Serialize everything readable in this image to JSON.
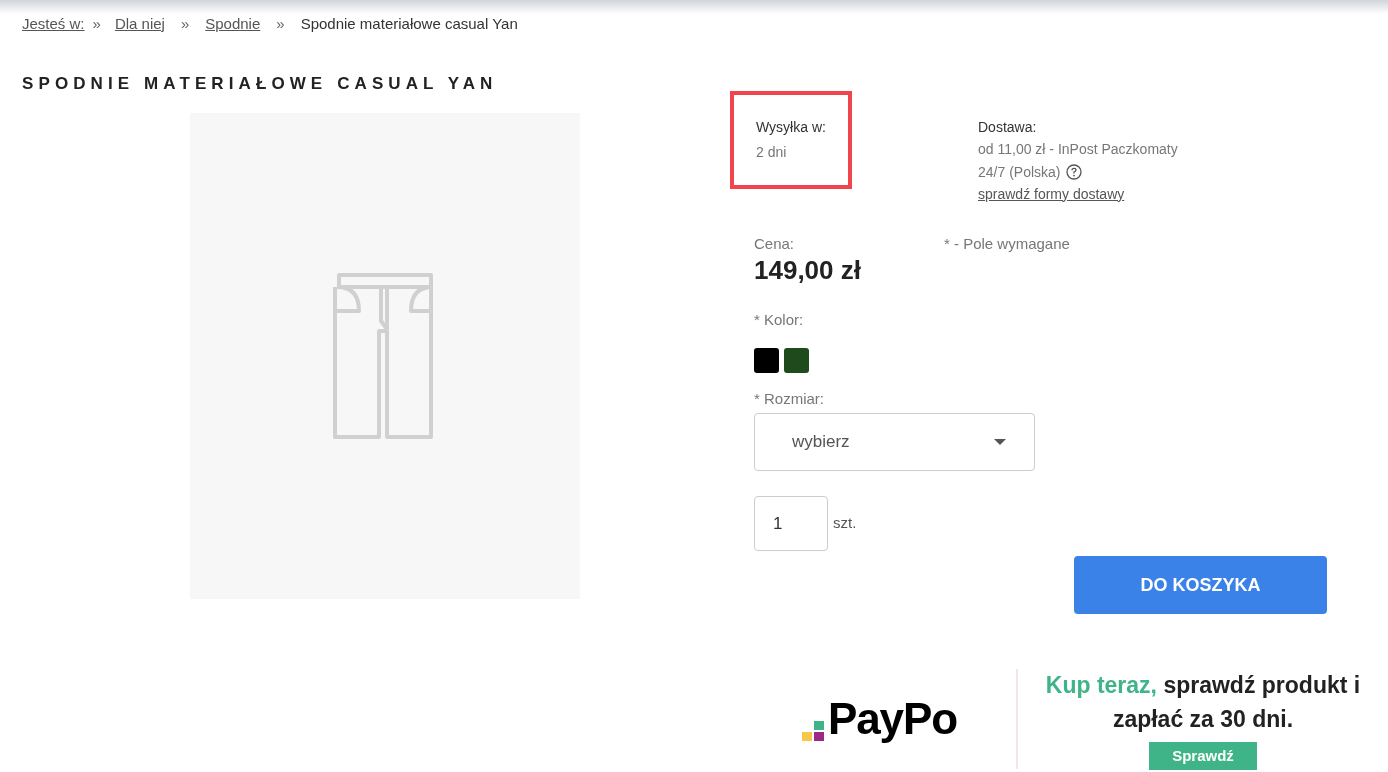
{
  "breadcrumbs": [
    {
      "label": "Jesteś w:",
      "link": true
    },
    {
      "label": "Dla niej",
      "link": true
    },
    {
      "label": "Spodnie",
      "link": true
    },
    {
      "label": "Spodnie materiałowe casual Yan",
      "link": false
    }
  ],
  "breadcrumb_separator": "»",
  "product_title": "SPODNIE MATERIAŁOWE CASUAL YAN",
  "shipping": {
    "label": "Wysyłka w:",
    "value": "2 dni",
    "highlighted": true
  },
  "delivery": {
    "label": "Dostawa:",
    "value": "od 11,00 zł - InPost Paczkomaty 24/7 (Polska)",
    "help_icon": true,
    "link": "sprawdź formy dostawy"
  },
  "price": {
    "label": "Cena:",
    "value": "149,00 zł"
  },
  "required_note": "* - Pole wymagane",
  "color": {
    "label": "* Kolor:",
    "swatches": [
      {
        "color": "#000000",
        "selected": false
      },
      {
        "color": "#1f4a1c",
        "selected": false
      }
    ]
  },
  "size": {
    "label": "* Rozmiar:",
    "value": "wybierz"
  },
  "quantity": {
    "value": "1",
    "unit": "szt."
  },
  "add_to_cart": "DO KOSZYKA",
  "paypo": {
    "logo": "PayPo",
    "headline_highlight": "Kup teraz,",
    "headline_rest": "sprawdź produkt i zapłać za 30 dni.",
    "button": "Sprawdź"
  }
}
